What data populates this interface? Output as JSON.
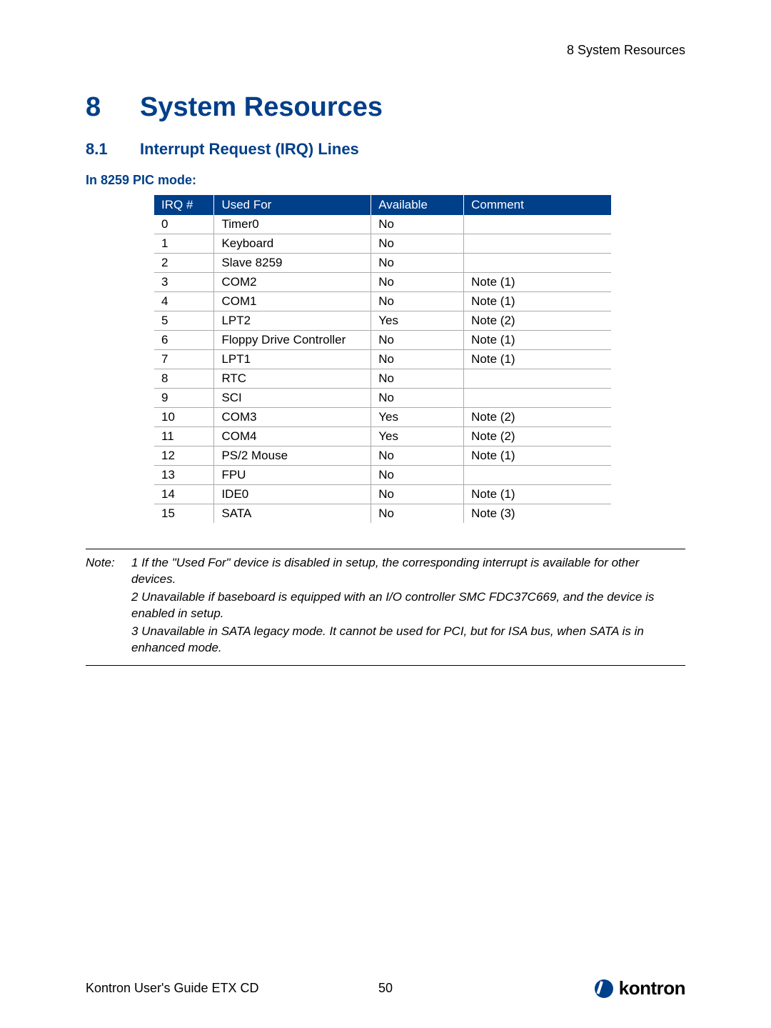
{
  "header_right": "8 System Resources",
  "h1": {
    "num": "8",
    "title": "System Resources"
  },
  "h2": {
    "num": "8.1",
    "title": "Interrupt Request (IRQ) Lines"
  },
  "h3": "In 8259 PIC mode:",
  "table": {
    "headers": [
      "IRQ #",
      "Used For",
      "Available",
      "Comment"
    ],
    "rows": [
      {
        "irq": "0",
        "used": "Timer0",
        "avail": "No",
        "comment": ""
      },
      {
        "irq": "1",
        "used": "Keyboard",
        "avail": "No",
        "comment": ""
      },
      {
        "irq": "2",
        "used": "Slave 8259",
        "avail": "No",
        "comment": ""
      },
      {
        "irq": "3",
        "used": "COM2",
        "avail": "No",
        "comment": "Note (1)"
      },
      {
        "irq": "4",
        "used": "COM1",
        "avail": "No",
        "comment": "Note (1)"
      },
      {
        "irq": "5",
        "used": "LPT2",
        "avail": "Yes",
        "comment": "Note (2)"
      },
      {
        "irq": "6",
        "used": "Floppy Drive Controller",
        "avail": "No",
        "comment": "Note (1)"
      },
      {
        "irq": "7",
        "used": "LPT1",
        "avail": "No",
        "comment": "Note (1)"
      },
      {
        "irq": "8",
        "used": "RTC",
        "avail": "No",
        "comment": ""
      },
      {
        "irq": "9",
        "used": "SCI",
        "avail": "No",
        "comment": ""
      },
      {
        "irq": "10",
        "used": "COM3",
        "avail": "Yes",
        "comment": "Note (2)"
      },
      {
        "irq": "11",
        "used": "COM4",
        "avail": "Yes",
        "comment": "Note (2)"
      },
      {
        "irq": "12",
        "used": "PS/2 Mouse",
        "avail": "No",
        "comment": "Note (1)"
      },
      {
        "irq": "13",
        "used": "FPU",
        "avail": "No",
        "comment": ""
      },
      {
        "irq": "14",
        "used": "IDE0",
        "avail": "No",
        "comment": "Note (1)"
      },
      {
        "irq": "15",
        "used": "SATA",
        "avail": "No",
        "comment": "Note (3)"
      }
    ]
  },
  "note": {
    "label": "Note:",
    "lines": [
      "1 If the \"Used For\" device is disabled in setup, the corresponding interrupt is available for other devices.",
      " 2 Unavailable if baseboard is equipped with an I/O controller SMC FDC37C669, and the device is enabled in setup.",
      "3 Unavailable in SATA legacy mode. It cannot be used for PCI, but for ISA bus, when SATA is in enhanced mode."
    ]
  },
  "footer": {
    "left": "Kontron User's Guide ETX CD",
    "page": "50",
    "brand": "kontron"
  }
}
